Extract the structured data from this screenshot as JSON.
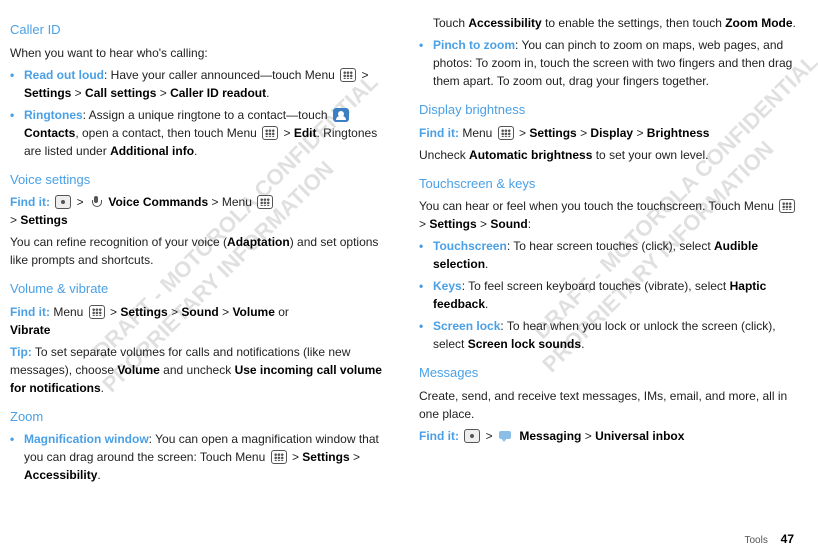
{
  "watermarks": {
    "line1": "DRAFT - MOTOROLA CONFIDENTIAL",
    "line2": "PROPRIETARY INFORMATION"
  },
  "col1": {
    "caller_id_title": "Caller ID",
    "caller_id_intro": "When you want to hear who's calling:",
    "read_out_loud_label": "Read out loud",
    "read_out_loud_text1": ": Have your caller announced—touch Menu ",
    "read_out_loud_text2": " > ",
    "settings": "Settings",
    "call_settings": "Call settings",
    "caller_id_readout": "Caller ID readout",
    "ringtones_label": "Ringtones",
    "ringtones_text1": ": Assign a unique ringtone to a contact—touch ",
    "contacts": "Contacts",
    "ringtones_text2": ", open a contact, then touch Menu ",
    "edit": "Edit",
    "ringtones_text3": ". Ringtones are listed under ",
    "additional_info": "Additional info",
    "voice_title": "Voice settings",
    "find_it": "Find it:",
    "voice_commands": "Voice Commands",
    "menu_label": "Menu",
    "voice_settings_path_end": "Settings",
    "voice_body": "You can refine recognition of your voice (",
    "adaptation": "Adaptation",
    "voice_body2": ") and set options like prompts and shortcuts.",
    "volume_title": "Volume & vibrate",
    "sound": "Sound",
    "volume": "Volume",
    "or": " or ",
    "vibrate": "Vibrate",
    "tip_label": "Tip:",
    "tip_text1": " To set separate volumes for calls and notifications (like new messages), choose ",
    "tip_text2": " and uncheck ",
    "use_incoming": "Use incoming call volume for notifications",
    "zoom_title": "Zoom",
    "mag_label": "Magnification window",
    "mag_text": ": You can open a magnification window that you can drag around the screen: Touch Menu ",
    "accessibility": "Accessibility"
  },
  "col2": {
    "zoom_cont1": "Touch ",
    "zoom_cont2": " to enable the settings, then touch ",
    "zoom_mode": "Zoom Mode",
    "pinch_label": "Pinch to zoom",
    "pinch_text": ": You can pinch to zoom on maps, web pages, and photos: To zoom in, touch the screen with two fingers and then drag them apart. To zoom out, drag your fingers together.",
    "display_title": "Display brightness",
    "display_path": "Display",
    "brightness": "Brightness",
    "display_body1": "Uncheck ",
    "auto_brightness": "Automatic brightness",
    "display_body2": " to set your own level.",
    "touch_title": "Touchscreen & keys",
    "touch_intro": "You can hear or feel when you touch the touchscreen. Touch Menu ",
    "touchscreen_label": "Touchscreen",
    "touchscreen_text": ": To hear screen touches (click), select ",
    "audible": "Audible selection",
    "keys_label": "Keys",
    "keys_text": ": To feel screen keyboard touches (vibrate), select ",
    "haptic": "Haptic feedback",
    "lock_label": "Screen lock",
    "lock_text": ": To hear when you lock or unlock the screen (click), select ",
    "lock_sounds": "Screen lock sounds",
    "msg_title": "Messages",
    "msg_body": "Create, send, and receive text messages, IMs, email, and more, all in one place.",
    "messaging": "Messaging",
    "universal": "Universal inbox"
  },
  "footer": {
    "section": "Tools",
    "page": "47"
  }
}
